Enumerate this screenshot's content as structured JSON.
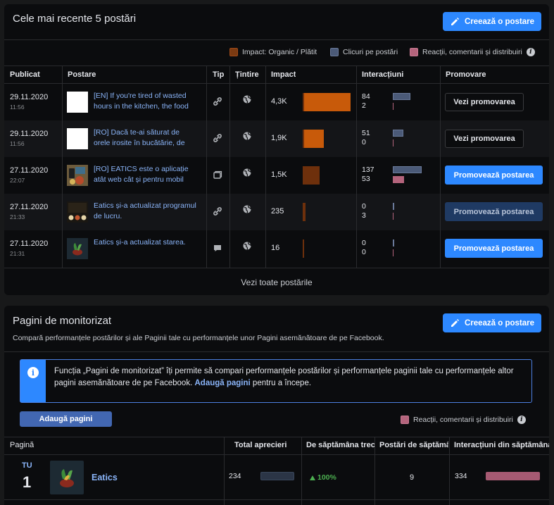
{
  "recent_posts": {
    "title": "Cele mai recente 5 postări",
    "create_button": "Creează o postare",
    "legend": [
      {
        "label": "Impact: Organic / Plătit",
        "color": "#7a3a12"
      },
      {
        "label": "Clicuri pe postări",
        "color": "#4b5a78"
      },
      {
        "label": "Reacții, comentarii și distribuiri",
        "color": "#b4647c"
      }
    ],
    "columns": [
      "Publicat",
      "Postare",
      "Tip",
      "Țintire",
      "Impact",
      "Interacțiuni",
      "Promovare"
    ],
    "rows": [
      {
        "date": "29.11.2020",
        "time": "11:56",
        "text": "[EN] If you're tired of wasted hours in the kitchen, the food",
        "type_icon": "link-icon",
        "impact": "4,3K",
        "impact_fraction": 1.0,
        "impact_color": "#c85a0a",
        "clicks": "84",
        "reactions": "2",
        "clicks_fraction": 0.61,
        "reactions_fraction": 0.015,
        "promo_label": "Vezi promovarea",
        "promo_style": "dark",
        "thumb": "white"
      },
      {
        "date": "29.11.2020",
        "time": "11:56",
        "text": "[RO] Dacă te-ai săturat de orele irosite în bucătărie, de",
        "type_icon": "link-icon",
        "impact": "1,9K",
        "impact_fraction": 0.44,
        "impact_color": "#c85a0a",
        "clicks": "51",
        "reactions": "0",
        "clicks_fraction": 0.37,
        "reactions_fraction": 0.0,
        "promo_label": "Vezi promovarea",
        "promo_style": "dark",
        "thumb": "white"
      },
      {
        "date": "27.11.2020",
        "time": "22:07",
        "text": "[RO] EATICS este o aplicație atât web cât și pentru mobil",
        "type_icon": "album-icon",
        "impact": "1,5K",
        "impact_fraction": 0.35,
        "impact_color": "#6e300c",
        "clicks": "137",
        "reactions": "53",
        "clicks_fraction": 1.0,
        "reactions_fraction": 0.39,
        "promo_label": "Promovează postarea",
        "promo_style": "blue",
        "thumb": "app"
      },
      {
        "date": "27.11.2020",
        "time": "21:33",
        "text": "Eatics și-a actualizat programul de lucru.",
        "type_icon": "link-icon",
        "impact": "235",
        "impact_fraction": 0.055,
        "impact_color": "#6e300c",
        "clicks": "0",
        "reactions": "3",
        "clicks_fraction": 0.0,
        "reactions_fraction": 0.022,
        "promo_label": "Promovează postarea",
        "promo_style": "disabled",
        "thumb": "schedule"
      },
      {
        "date": "27.11.2020",
        "time": "21:31",
        "text": "Eatics și-a actualizat starea.",
        "type_icon": "status-icon",
        "impact": "16",
        "impact_fraction": 0.004,
        "impact_color": "#6e300c",
        "clicks": "0",
        "reactions": "0",
        "clicks_fraction": 0.0,
        "reactions_fraction": 0.0,
        "promo_label": "Promovează postarea",
        "promo_style": "blue",
        "thumb": "logo"
      }
    ],
    "see_all": "Vezi toate postările"
  },
  "monitor": {
    "title": "Pagini de monitorizat",
    "create_button": "Creează o postare",
    "subtitle": "Compară performanțele postărilor și ale Paginii tale cu performanțele unor Pagini asemănătoare de pe Facebook.",
    "info_text": "Funcția „Pagini de monitorizat” îți permite să compari performanțele postărilor și performanțele paginii tale cu performanțele altor pagini asemănătoare de pe Facebook.",
    "info_link": "Adaugă pagini",
    "info_suffix": "pentru a începe.",
    "add_button": "Adaugă pagini",
    "legend": {
      "label": "Reacții, comentarii și distribuiri",
      "color": "#b4647c"
    },
    "columns": [
      "Pagină",
      "Total aprecieri",
      "De săptămâna trecută",
      "Postări de săptămâna aceasta",
      "Interacțiuni din săptămâna aceasta"
    ],
    "row": {
      "tag": "TU",
      "rank": "1",
      "name": "Eatics",
      "total_likes": "234",
      "growth": "100%",
      "posts": "9",
      "interactions": "334"
    }
  }
}
